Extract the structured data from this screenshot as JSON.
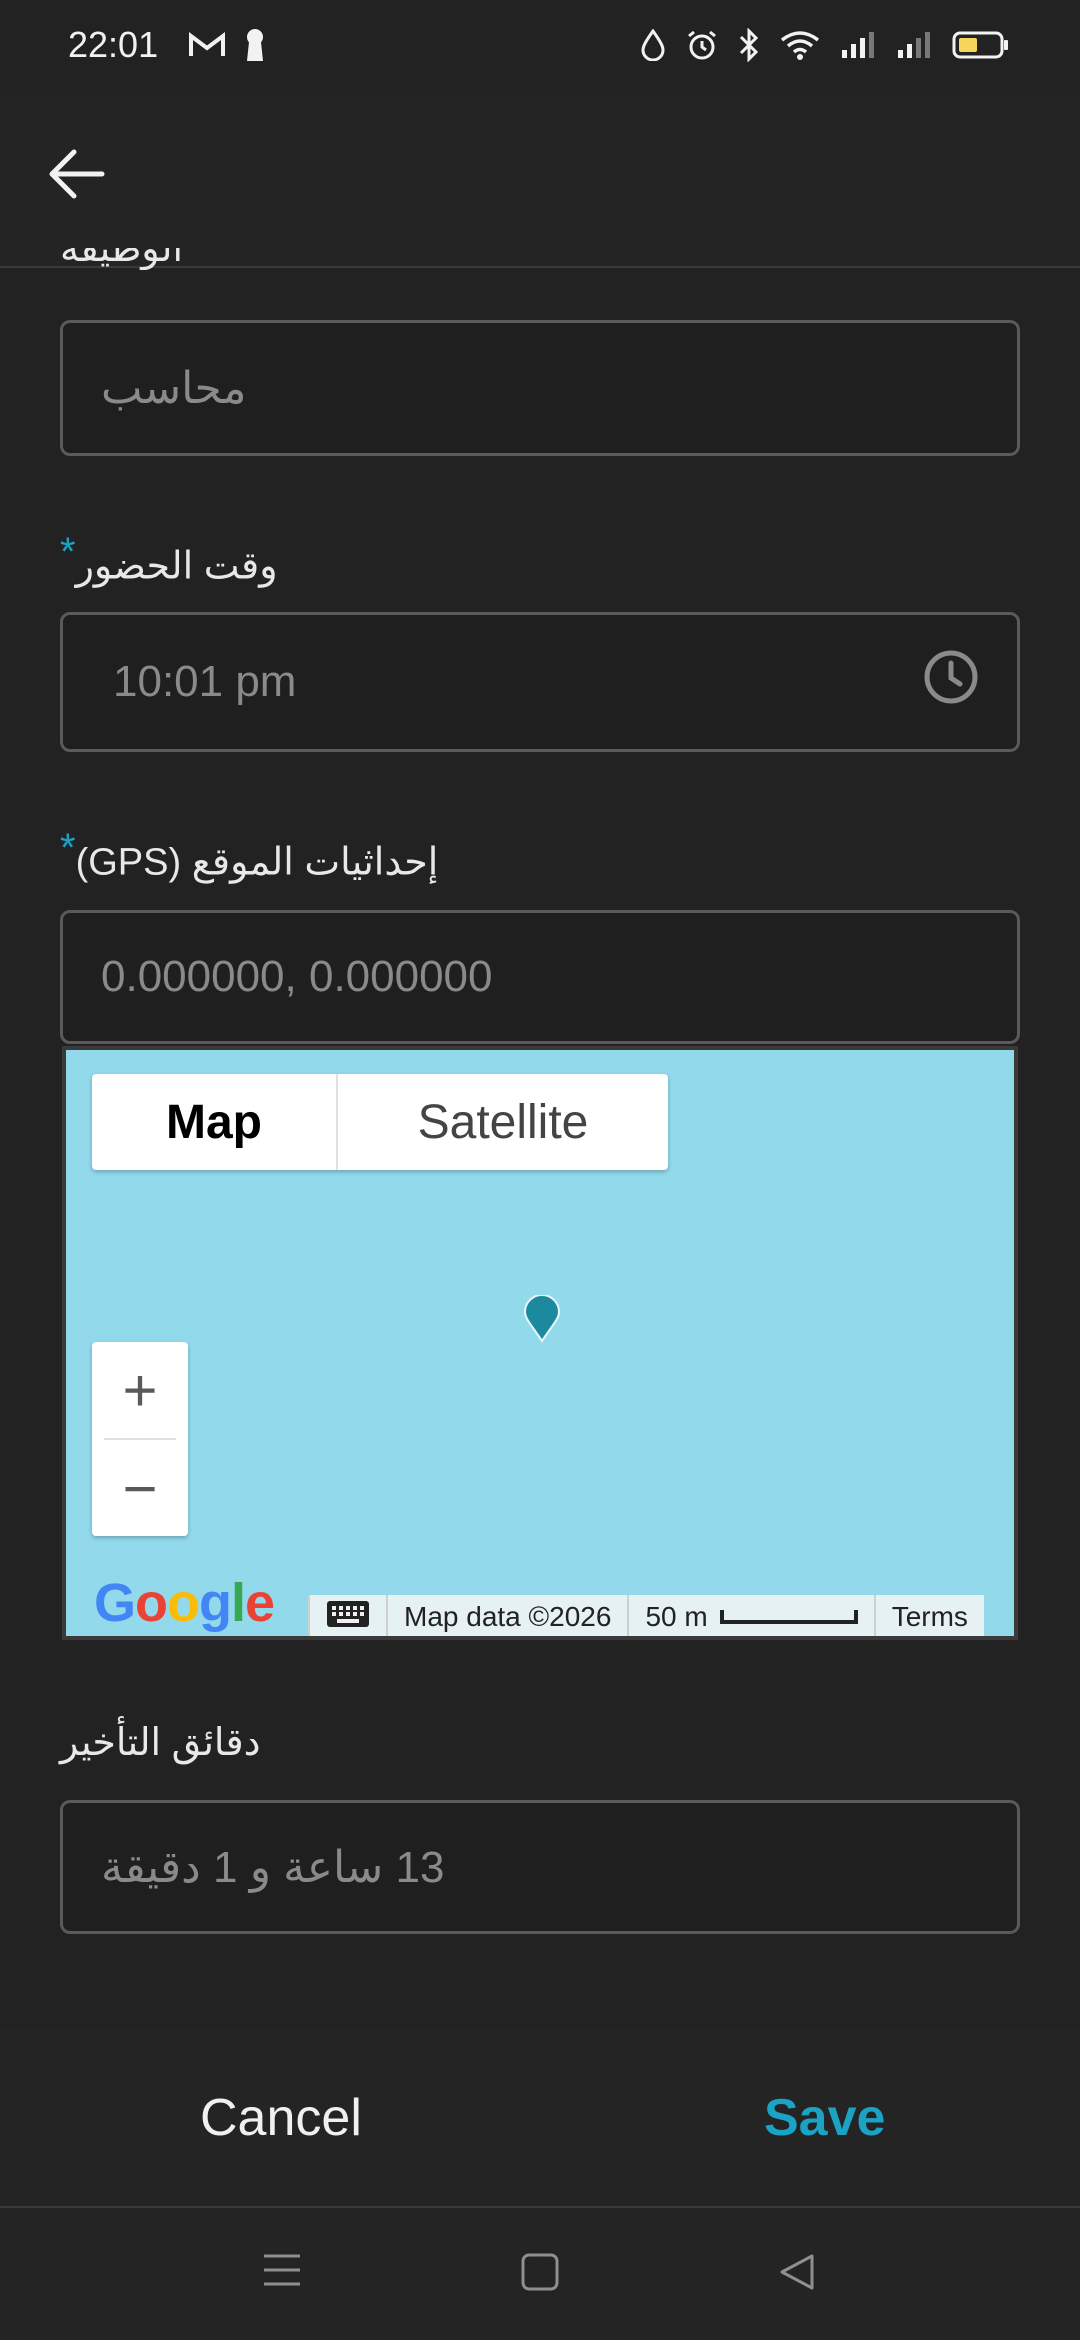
{
  "status_bar": {
    "time": "22:01",
    "icons": [
      "gmail-icon",
      "keyhole-icon",
      "drop-icon",
      "alarm-icon",
      "bluetooth-icon",
      "wifi-icon",
      "signal-icon",
      "signal-icon-2",
      "battery-icon"
    ]
  },
  "appbar": {
    "back_icon": "arrow-left-icon"
  },
  "form": {
    "job_label": "الوظيفة",
    "job_value": "محاسب",
    "attendance_label": "وقت الحضور",
    "attendance_required": "*",
    "attendance_value": "10:01 pm",
    "gps_label": "إحداثيات الموقع (GPS)",
    "gps_required": "*",
    "gps_value": "0.000000, 0.000000",
    "delay_label": "دقائق التأخير",
    "delay_value": "13 ساعة و 1 دقيقة"
  },
  "map": {
    "tab_map": "Map",
    "tab_satellite": "Satellite",
    "zoom_in": "+",
    "zoom_out": "−",
    "logo": "Google",
    "map_data": "Map data ©2026",
    "scale": "50 m",
    "terms": "Terms",
    "water_color": "#92d9ec",
    "pin_color": "#1b8a9e"
  },
  "actions": {
    "cancel": "Cancel",
    "save": "Save"
  },
  "colors": {
    "accent": "#1aa3c4",
    "background": "#222222"
  }
}
